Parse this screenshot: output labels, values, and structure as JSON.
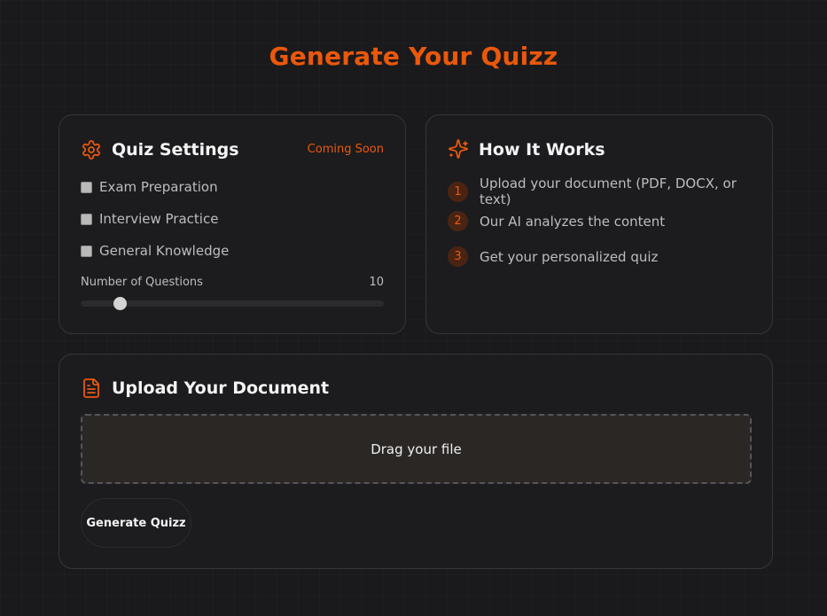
{
  "page": {
    "title": "Generate Your Quizz"
  },
  "colors": {
    "accent": "#ea580c",
    "background": "#1a1a1c",
    "card": "#1c1c1e",
    "border": "#36363a"
  },
  "settings": {
    "icon": "gear-icon",
    "title": "Quiz Settings",
    "badge": "Coming Soon",
    "options": [
      {
        "label": "Exam Preparation",
        "checked": false
      },
      {
        "label": "Interview Practice",
        "checked": false
      },
      {
        "label": "General Knowledge",
        "checked": false
      }
    ],
    "questions_label": "Number of Questions",
    "questions_value": "10",
    "slider_fraction": 0.13
  },
  "how": {
    "icon": "sparkles-icon",
    "title": "How It Works",
    "steps": [
      {
        "num": "1",
        "text": "Upload your document (PDF, DOCX, or text)"
      },
      {
        "num": "2",
        "text": "Our AI analyzes the content"
      },
      {
        "num": "3",
        "text": "Get your personalized quiz"
      }
    ]
  },
  "upload": {
    "icon": "document-icon",
    "title": "Upload Your Document",
    "dropzone_text": "Drag your file",
    "generate_label": "Generate Quizz"
  }
}
